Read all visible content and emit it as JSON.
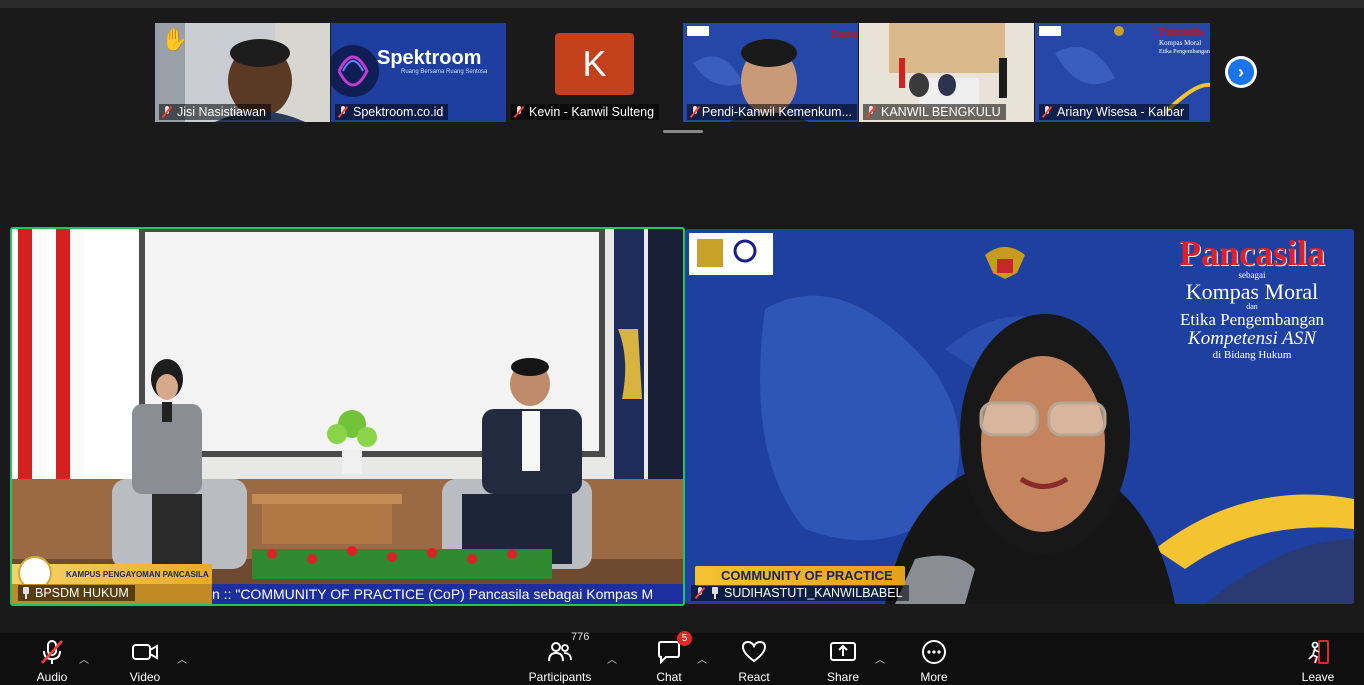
{
  "thumbnails": [
    {
      "name": "Jisi Nasistiawan"
    },
    {
      "name": "Spektroom.co.id",
      "logo": "Spektroom",
      "tagline": "Ruang Bersama Ruang Sentosa"
    },
    {
      "name": "Kevin - Kanwil Sulteng",
      "initial": "K"
    },
    {
      "name": "Pendi-Kanwil Kemenkum..."
    },
    {
      "name": "KANWIL BENGKULU"
    },
    {
      "name": "Ariany Wisesa - Kalbar"
    }
  ],
  "main_video_left": {
    "name": "BPSDM HUKUM",
    "lower_third": "KAMPUS PENGAYOMAN PANCASILA",
    "ticker": "n :: \"COMMUNITY OF PRACTICE (CoP) Pancasila sebagai Kompas M"
  },
  "main_video_right": {
    "name": "SUDIHASTUTI_KANWILBABEL",
    "title_line1": "Pancasila",
    "title_line2": "sebagai",
    "title_line3": "Kompas Moral",
    "title_line4": "dan",
    "title_line5": "Etika Pengembangan",
    "title_line6": "Kompetensi ASN",
    "title_line7": "di Bidang Hukum",
    "banner": "COMMUNITY OF PRACTICE"
  },
  "toolbar": {
    "audio": "Audio",
    "video": "Video",
    "participants": "Participants",
    "participants_count": "776",
    "chat": "Chat",
    "chat_badge": "5",
    "react": "React",
    "share": "Share",
    "more": "More",
    "leave": "Leave"
  },
  "colors": {
    "active_speaker_border": "#21c55d",
    "leave_red": "#e02828",
    "next_blue": "#1a73e8"
  }
}
